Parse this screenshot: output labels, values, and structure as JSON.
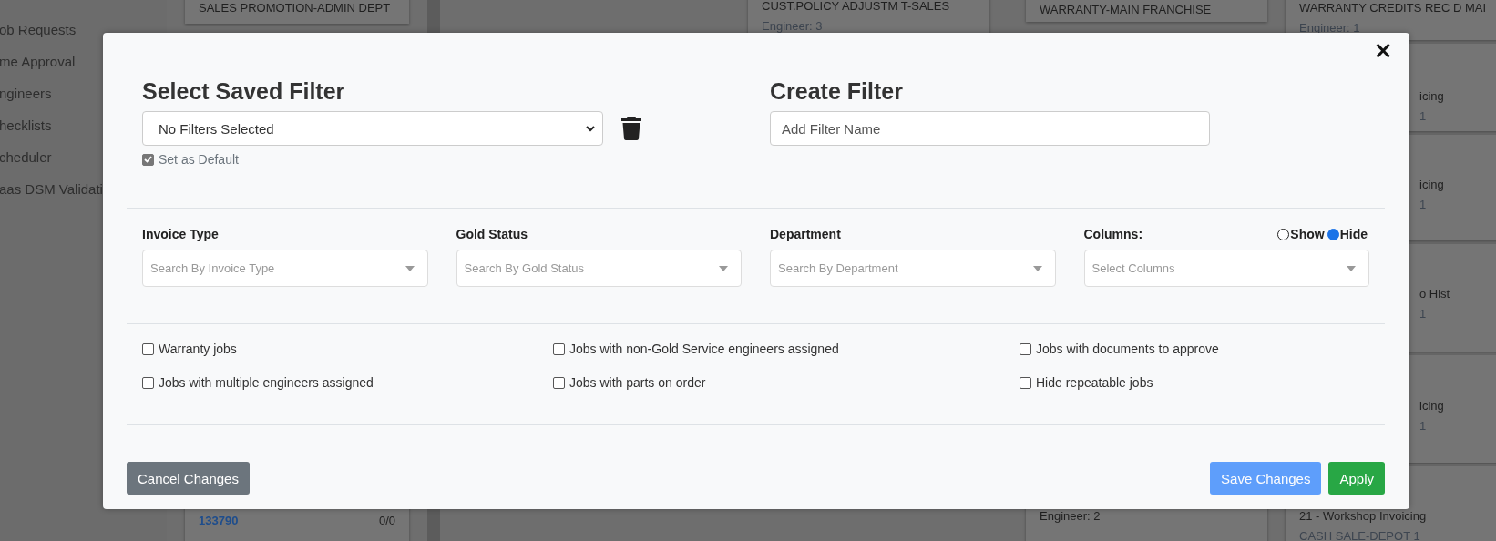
{
  "sidebar": {
    "items": [
      "ob Requests",
      "me Approval",
      "ngineers",
      "hecklists",
      "cheduler",
      "aas DSM Validati"
    ]
  },
  "board": {
    "columns": [
      {
        "cards": [
          {
            "lines": [
              "SALES PROMOTION-ADMIN DEPT"
            ]
          },
          {
            "job_number": "133790",
            "count": "0/0"
          }
        ]
      },
      {
        "cards": [
          {
            "lines": [
              "CUST.POLICY ADJUSTM T-SALES",
              "Engineer: 3"
            ]
          }
        ]
      },
      {
        "cards": [
          {
            "lines": [
              "WARRANTY-MAIN FRANCHISE"
            ]
          },
          {
            "lines": [
              "Engineer: 2"
            ]
          }
        ]
      },
      {
        "cards": [
          {
            "lines": [
              "WARRANTY CREDITS REC D MAI",
              "Engineer: 1"
            ]
          },
          {
            "lines": [
              "icing",
              "1"
            ]
          },
          {
            "lines": [
              "icing",
              "1"
            ]
          },
          {
            "lines": [
              "o Hist",
              "1"
            ]
          },
          {
            "lines": [
              "icing",
              "1"
            ]
          },
          {
            "lines": [
              "21 - Workshop Invoicing",
              "CASH SALE-DEPOT 1"
            ]
          }
        ]
      }
    ]
  },
  "modal": {
    "close": "×",
    "saved_filter": {
      "heading": "Select Saved Filter",
      "value": "No Filters Selected",
      "set_default": {
        "label": "Set as Default",
        "checked": true
      }
    },
    "create_filter": {
      "heading": "Create Filter",
      "placeholder": "Add Filter Name"
    },
    "filters": [
      {
        "label": "Invoice Type",
        "placeholder": "Search By Invoice Type"
      },
      {
        "label": "Gold Status",
        "placeholder": "Search By Gold Status"
      },
      {
        "label": "Department",
        "placeholder": "Search By Department"
      },
      {
        "label": "Columns:",
        "placeholder": "Select Columns"
      }
    ],
    "columns_toggle": [
      {
        "label": "Show",
        "selected": false
      },
      {
        "label": "Hide",
        "selected": true
      }
    ],
    "options": [
      {
        "label": "Warranty jobs",
        "checked": false
      },
      {
        "label": "Jobs with non-Gold Service engineers assigned",
        "checked": false
      },
      {
        "label": "Jobs with documents to approve",
        "checked": false
      },
      {
        "label": "Jobs with multiple engineers assigned",
        "checked": false
      },
      {
        "label": "Jobs with parts on order",
        "checked": false
      },
      {
        "label": "Hide repeatable jobs",
        "checked": false
      }
    ],
    "buttons": [
      {
        "label": "Cancel Changes",
        "kind": "secondary",
        "disabled": false
      },
      {
        "label": "Save Changes",
        "kind": "primary",
        "disabled": true
      },
      {
        "label": "Apply",
        "kind": "success",
        "disabled": false
      }
    ]
  }
}
